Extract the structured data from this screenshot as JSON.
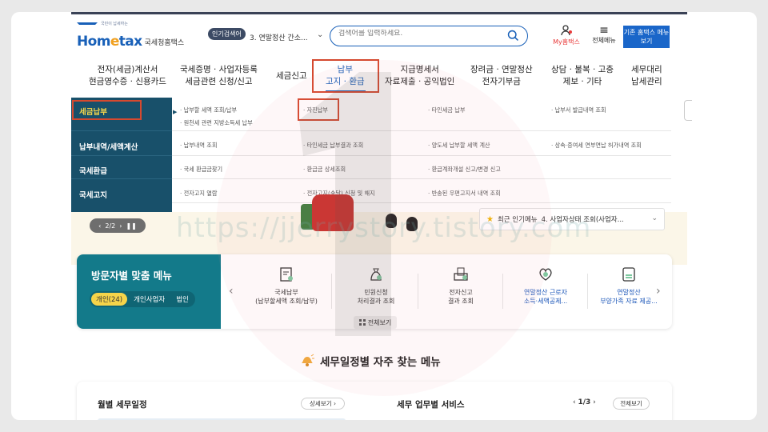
{
  "header": {
    "logo_brand": "Hometax",
    "logo_brand_e": "e",
    "logo_sub": "국세청홈택스",
    "logo_tiny": "국민이 납세하는",
    "popular_badge": "인기검색어",
    "popular_item": "3. 연말정산 간소...",
    "search_placeholder": "검색어를 입력하세요.",
    "my_label": "My홈택스",
    "all_menu_label": "전체메뉴",
    "old_home_label": "기존 홈택스 메뉴 보기"
  },
  "gnb": [
    {
      "line1": "전자(세금)계산서",
      "line2": "현금영수증 · 신용카드"
    },
    {
      "line1": "국세증명 · 사업자등록",
      "line2": "세금관련 신청/신고"
    },
    {
      "line1": "세금신고",
      "line2": ""
    },
    {
      "line1": "납부",
      "line2": "고지 · 환급"
    },
    {
      "line1": "지급명세서",
      "line2": "자료제출 · 공익법인"
    },
    {
      "line1": "장려금 · 연말정산",
      "line2": "전자기부금"
    },
    {
      "line1": "상담 · 불복 · 고충",
      "line2": "제보 · 기타"
    },
    {
      "line1": "세무대리",
      "line2": "납세관리"
    }
  ],
  "mega": {
    "rows": [
      {
        "cat": "세금납부",
        "links": [
          "· 납부할 세액 조회/납부",
          "· 자진납부",
          "· 타인세금 납부",
          "· 납부서 발급내역 조회"
        ],
        "extra": "· 원천세 관련 지방소득세 납부"
      },
      {
        "cat": "납부내역/세액계산",
        "links": [
          "· 납부내역 조회",
          "· 타인세금 납부결과 조회",
          "· 양도세 납부할 세액 계산",
          "· 상속·증여세 연부연납 허가내역 조회"
        ]
      },
      {
        "cat": "국세환급",
        "links": [
          "· 국세 환급금찾기",
          "· 환급금 상세조회",
          "· 환급계좌개설 신고/변경 신고",
          ""
        ]
      },
      {
        "cat": "국세고지",
        "links": [
          "· 전자고지 열람",
          "· 전자고지(송달) 신청 및 해지",
          "· 반송된 우편고지서 내역 조회",
          ""
        ]
      }
    ]
  },
  "banner": {
    "pager": "2/2",
    "popular_menu_label": "최근 인기메뉴",
    "popular_menu_item": "4.  사업자상태 조회(사업자..."
  },
  "visitor": {
    "title": "방문자별 맞춤 메뉴",
    "tabs": [
      "개인(24)",
      "개인사업자",
      "법인"
    ],
    "services": [
      {
        "line1": "국세납부",
        "line2": "(납부할세액 조회/납부)",
        "icon": "tax-payment-icon"
      },
      {
        "line1": "민원신청",
        "line2": "처리결과 조회",
        "icon": "petition-icon"
      },
      {
        "line1": "전자신고",
        "line2": "결과 조회",
        "icon": "e-filing-icon"
      },
      {
        "line1": "연말정산 근로자",
        "line2": "소득·세액공제...",
        "icon": "year-end-worker-icon"
      },
      {
        "line1": "연말정산",
        "line2": "부양가족 자료 제공...",
        "icon": "year-end-family-icon"
      }
    ],
    "view_all": "전체보기"
  },
  "section": {
    "title": "세무일정별 자주 찾는 메뉴"
  },
  "bottom": {
    "schedule_title": "월별 세무일정",
    "detail_button": "상세보기",
    "service_title": "세무 업무별 서비스",
    "page": "1/3",
    "view_all": "전체보기"
  },
  "watermark_text": "https://jjerrystory.tistory.com",
  "colors": {
    "brand_blue": "#1860b8",
    "mega_side": "#18506a",
    "card_teal": "#137a8a",
    "highlight_red": "#d5492f",
    "tab_yellow": "#f5d44a"
  }
}
